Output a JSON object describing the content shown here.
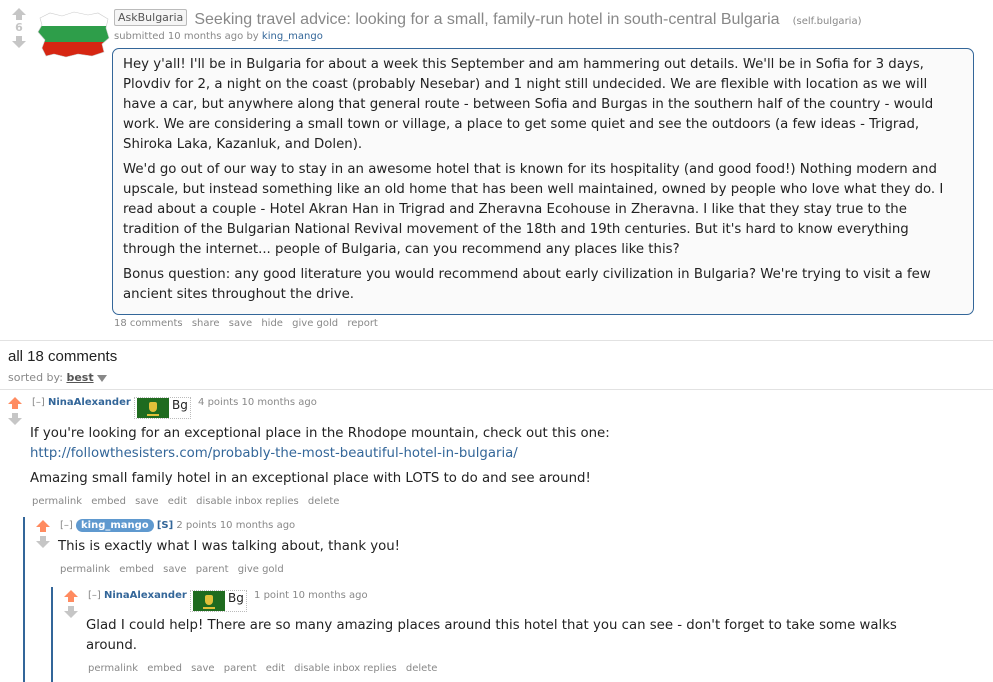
{
  "post": {
    "score": "6",
    "flair": "AskBulgaria",
    "title": "Seeking travel advice: looking for a small, family-run hotel in south-central Bulgaria",
    "domain": "(self.bulgaria)",
    "submitted_prefix": "submitted 10 months ago by",
    "author": "king_mango",
    "paragraphs": [
      "Hey y'all! I'll be in Bulgaria for about a week this September and am hammering out details. We'll be in Sofia for 3 days, Plovdiv for 2, a night on the coast (probably Nesebar) and 1 night still undecided. We are flexible with location as we will have a car, but anywhere along that general route - between Sofia and Burgas in the southern half of the country - would work. We are considering a small town or village, a place to get some quiet and see the outdoors (a few ideas - Trigrad, Shiroka Laka, Kazanluk, and Dolen).",
      "We'd go out of our way to stay in an awesome hotel that is known for its hospitality (and good food!) Nothing modern and upscale, but instead something like an old home that has been well maintained, owned by people who love what they do. I read about a couple - Hotel Akran Han in Trigrad and Zheravna Ecohouse in Zheravna. I like that they stay true to the tradition of the Bulgarian National Revival movement of the 18th and 19th centuries. But it's hard to know everything through the internet... people of Bulgaria, can you recommend any places like this?",
      "Bonus question: any good literature you would recommend about early civilization in Bulgaria? We're trying to visit a few ancient sites throughout the drive."
    ],
    "buttons": [
      "18 comments",
      "share",
      "save",
      "hide",
      "give gold",
      "report"
    ]
  },
  "comments_header": {
    "title": "all 18 comments",
    "sorted_label": "sorted by:",
    "sort_value": "best"
  },
  "comments": [
    {
      "collapse": "[–]",
      "author": "NinaAlexander",
      "flair_text": "Bg",
      "meta": "4 points 10 months ago",
      "line1": "If you're looking for an exceptional place in the Rhodope mountain, check out this one:",
      "link": "http://followthesisters.com/probably-the-most-beautiful-hotel-in-bulgaria/",
      "line2": "Amazing small family hotel in an exceptional place with LOTS to do and see around!",
      "buttons": [
        "permalink",
        "embed",
        "save",
        "edit",
        "disable inbox replies",
        "delete"
      ]
    },
    {
      "collapse": "[–]",
      "author": "king_mango",
      "submitter": "[S]",
      "meta": "2 points 10 months ago",
      "line1": "This is exactly what I was talking about, thank you!",
      "buttons": [
        "permalink",
        "embed",
        "save",
        "parent",
        "give gold"
      ]
    },
    {
      "collapse": "[–]",
      "author": "NinaAlexander",
      "flair_text": "Bg",
      "meta": "1 point 10 months ago",
      "line1": "Glad I could help! There are so many amazing places around this hotel that you can see - don't forget to take some walks around.",
      "buttons": [
        "permalink",
        "embed",
        "save",
        "parent",
        "edit",
        "disable inbox replies",
        "delete"
      ]
    }
  ],
  "colors": {
    "upvote": "#ff8b60",
    "neutral_arrow": "#c6c6c6",
    "link": "#336699",
    "op_badge": "#5f99cf"
  }
}
